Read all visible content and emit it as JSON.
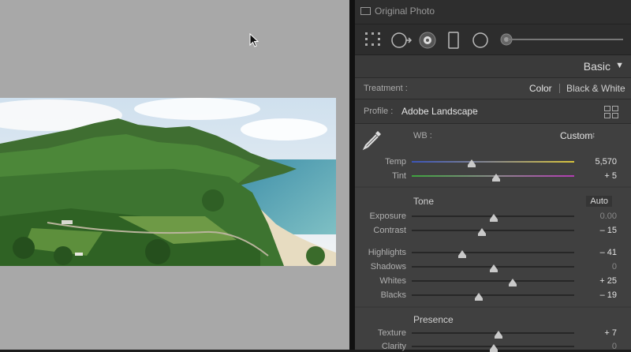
{
  "window": {
    "original_photo_label": "Original Photo"
  },
  "icons": {
    "cursor": "arrow-cursor-icon",
    "tools": [
      "crop-grid-icon",
      "spot-removal-icon",
      "red-eye-icon",
      "graduated-filter-icon",
      "radial-filter-icon",
      "brush-icon"
    ]
  },
  "panel": {
    "title": "Basic"
  },
  "treatment": {
    "label": "Treatment :",
    "color": "Color",
    "bw": "Black & White"
  },
  "profile": {
    "label": "Profile :",
    "value": "Adobe Landscape",
    "chooser_arrow": "↕"
  },
  "wb": {
    "label": "WB :",
    "value": "Custom",
    "chooser_arrow": "↕"
  },
  "temp": {
    "label": "Temp",
    "value": "5,570",
    "position": 0.37
  },
  "tint": {
    "label": "Tint",
    "value": "+ 5",
    "position": 0.51
  },
  "tone": {
    "title": "Tone",
    "auto": "Auto"
  },
  "exposure": {
    "label": "Exposure",
    "value": "0.00",
    "position": 0.5
  },
  "contrast": {
    "label": "Contrast",
    "value": "– 15",
    "position": 0.43
  },
  "highlights": {
    "label": "Highlights",
    "value": "– 41",
    "position": 0.3
  },
  "shadows": {
    "label": "Shadows",
    "value": "0",
    "position": 0.5
  },
  "whites": {
    "label": "Whites",
    "value": "+ 25",
    "position": 0.62
  },
  "blacks": {
    "label": "Blacks",
    "value": "– 19",
    "position": 0.41
  },
  "presence": {
    "title": "Presence"
  },
  "texture": {
    "label": "Texture",
    "value": "+ 7",
    "position": 0.53
  },
  "clarity": {
    "label": "Clarity",
    "value": "0",
    "position": 0.5
  },
  "colors": {
    "canvas_bg": "#a8a8a8",
    "panel_bg": "#3a3a3a",
    "section_bg": "#404040"
  }
}
